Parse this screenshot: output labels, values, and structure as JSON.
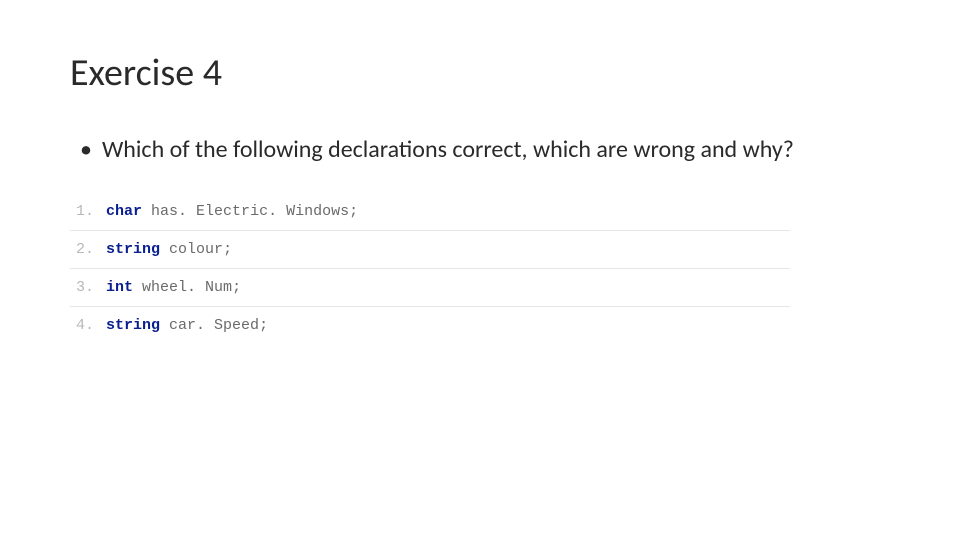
{
  "title": "Exercise 4",
  "bullet": {
    "text": "Which of the following declarations correct, which are wrong and why?"
  },
  "code": {
    "lines": [
      {
        "num": "1.",
        "keyword": "char",
        "ident": "has. Electric. Windows",
        "semi": ";"
      },
      {
        "num": "2.",
        "keyword": "string",
        "ident": "colour",
        "semi": ";"
      },
      {
        "num": "3.",
        "keyword": "int",
        "ident": "wheel. Num",
        "semi": ";"
      },
      {
        "num": "4.",
        "keyword": "string",
        "ident": "car. Speed",
        "semi": ";"
      }
    ]
  }
}
